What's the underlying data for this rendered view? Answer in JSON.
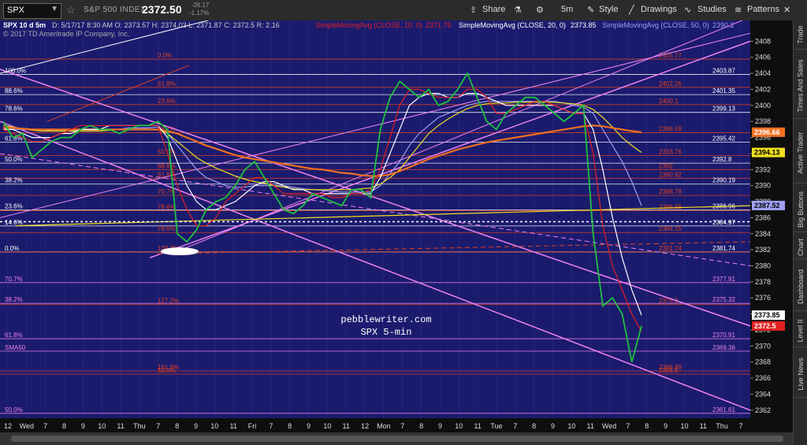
{
  "toolbar": {
    "symbol": "SPX",
    "index_name": "S&P 500 INDEX",
    "price": "2372.50",
    "change": "-26.17",
    "change_pct": "-1.17%",
    "share": "Share",
    "interval": "5m",
    "style": "Style",
    "drawings": "Drawings",
    "studies": "Studies",
    "patterns": "Patterns"
  },
  "sidebar": [
    "Trade",
    "Times And Sales",
    "Active Trader",
    "Big Buttons",
    "Chart",
    "Dashboard",
    "Level II",
    "Live News"
  ],
  "chart_data": {
    "type": "line",
    "title": "SPX 10 d 5m",
    "header_info": "D: 5/17/17 8:30 AM  O: 2373.57  H: 2374.03  L: 2371.87  C: 2372.5  R: 2.16",
    "studies": [
      {
        "label": "SimpleMovingAvg (CLOSE, 10, 0)",
        "value": "2371.79",
        "color": "#e02020"
      },
      {
        "label": "SimpleMovingAvg (CLOSE, 20, 0)",
        "value": "2373.85",
        "color": "#ffffff"
      },
      {
        "label": "SimpleMovingAvg (CLOSE, 50, 0)",
        "value": "2390.2",
        "color": "#9f9ff4"
      }
    ],
    "copyright": "© 2017 TD Ameritrade IP Company, Inc.",
    "watermark": [
      "pebblewriter.com",
      "SPX 5-min"
    ],
    "ylim": [
      2361,
      2410
    ],
    "y_ticks": [
      2362,
      2364,
      2366,
      2368,
      2370,
      2372,
      2374,
      2376,
      2378,
      2380,
      2382,
      2384,
      2386,
      2388,
      2390,
      2392,
      2394,
      2396,
      2398,
      2400,
      2402,
      2404,
      2406,
      2408
    ],
    "x_ticks": [
      "12",
      "Wed",
      "7",
      "8",
      "9",
      "10",
      "11",
      "Thu",
      "7",
      "8",
      "9",
      "10",
      "11",
      "Fri",
      "7",
      "8",
      "9",
      "10",
      "11",
      "12",
      "Mon",
      "7",
      "8",
      "9",
      "10",
      "11",
      "Tue",
      "7",
      "8",
      "9",
      "10",
      "11",
      "Wed",
      "7",
      "8",
      "9",
      "10",
      "11",
      "Thu",
      "7"
    ],
    "price_tags": [
      {
        "value": "2396.66",
        "color": "#f07020"
      },
      {
        "value": "2394.13",
        "color": "#f0e020"
      },
      {
        "value": "2387.52",
        "color": "#9f9ff4"
      },
      {
        "value": "2373.85",
        "color": "#ffffff"
      },
      {
        "value": "2372.5",
        "color": "#e02020"
      }
    ],
    "horizontal_levels": [
      {
        "value": 2405.77,
        "label_left": "0.0%",
        "label_right": "2405.77",
        "color": "#e04020"
      },
      {
        "value": 2403.87,
        "label_left": "100.0%",
        "label_right": "2403.87",
        "color": "#ffffff"
      },
      {
        "value": 2402.26,
        "label_left": "61.8%",
        "label_right": "2402.26",
        "color": "#e04020"
      },
      {
        "value": 2401.35,
        "label_left": "88.6%",
        "label_right": "2401.35",
        "color": "#ffffff"
      },
      {
        "value": 2400.1,
        "label_left": "23.6%",
        "label_right": "2400.1",
        "color": "#e04020"
      },
      {
        "value": 2399.13,
        "label_left": "78.6%",
        "label_right": "2399.13",
        "color": "#ffffff"
      },
      {
        "value": 2396.59,
        "label_left": "38.2%",
        "label_right": "2396.59",
        "color": "#e04020"
      },
      {
        "value": 2395.42,
        "label_left": "61.8%",
        "label_right": "2395.42",
        "color": "#ffffff"
      },
      {
        "value": 2393.76,
        "label_left": "50.0%",
        "label_right": "2393.76",
        "color": "#e04020"
      },
      {
        "value": 2392.8,
        "label_left": "50.0%",
        "label_right": "2392.8",
        "color": "#ffffff"
      },
      {
        "value": 2392,
        "label_left": "88.6%",
        "label_right": "2392",
        "color": "#e04020"
      },
      {
        "value": 2390.92,
        "label_left": "61.8%",
        "label_right": "2390.92",
        "color": "#e04020"
      },
      {
        "value": 2390.19,
        "label_left": "38.2%",
        "label_right": "2390.19",
        "color": "#ffffff"
      },
      {
        "value": 2388.78,
        "label_left": "70.7%",
        "label_right": "2388.78",
        "color": "#e04020"
      },
      {
        "value": 2386.96,
        "label_left": "23.6%",
        "label_right": "2386.96",
        "color": "#ffffff"
      },
      {
        "value": 2386.88,
        "label_left": "78.6%",
        "label_right": "2386.88",
        "color": "#e04020"
      },
      {
        "value": 2384.97,
        "label_left": "14.6%",
        "label_right": "2384.97",
        "color": "#ffffff"
      },
      {
        "value": 2384.15,
        "label_left": "78.6%",
        "label_right": "2384.15",
        "color": "#e04020"
      },
      {
        "value": 2381.74,
        "label_left": "0.0%",
        "label_right": "2381.74",
        "color": "#ffffff"
      },
      {
        "value": 2381.74,
        "label_left": "100.0%",
        "label_right": "2381.74",
        "color": "#e04020"
      },
      {
        "value": 2377.91,
        "label_left": "70.7%",
        "label_right": "2377.91",
        "color": "#ee82ee"
      },
      {
        "value": 2375.32,
        "label_left": "38.2%",
        "label_right": "2375.32",
        "color": "#ee82ee"
      },
      {
        "value": 2375.2,
        "label_left": "127.2%",
        "label_right": "2375.2",
        "color": "#e04020"
      },
      {
        "value": 2370.91,
        "label_left": "61.8%",
        "label_right": "2370.91",
        "color": "#ee82ee"
      },
      {
        "value": 2369.36,
        "label_left": "SMA50",
        "label_right": "2369.36",
        "color": "#ee82ee"
      },
      {
        "value": 2366.89,
        "label_left": "161.8%",
        "label_right": "2366.89",
        "color": "#e04020"
      },
      {
        "value": 2366.5,
        "label_left": "50.0%",
        "label_right": "2366.5",
        "color": "#e04020"
      },
      {
        "value": 2361.61,
        "label_left": "50.0%",
        "label_right": "2361.61",
        "color": "#ee82ee"
      }
    ],
    "series": [
      {
        "name": "SPX",
        "color": "#20c040",
        "values": [
          2398,
          2396,
          2396.5,
          2393.5,
          2394.5,
          2395.5,
          2396,
          2396,
          2397,
          2397.5,
          2397,
          2397,
          2396.5,
          2397,
          2397.5,
          2397.5,
          2398,
          2397,
          2384,
          2383,
          2384.5,
          2387,
          2388,
          2388.5,
          2390,
          2392,
          2393,
          2391,
          2389,
          2387,
          2386.5,
          2387.5,
          2389,
          2388.5,
          2388,
          2387.5,
          2389.5,
          2389.5,
          2388.5,
          2397,
          2401,
          2403,
          2402,
          2401,
          2402,
          2400,
          2400.5,
          2402,
          2404,
          2401,
          2398,
          2397,
          2399,
          2400,
          2401,
          2401,
          2400,
          2399,
          2398,
          2399,
          2400,
          2384,
          2375,
          2376,
          2374,
          2368,
          2372.5
        ]
      },
      {
        "name": "SMA10",
        "color": "#e02020",
        "values": [
          2397,
          2396.5,
          2396,
          2395.5,
          2395.5,
          2396,
          2396.5,
          2397,
          2397.5,
          2397.5,
          2397.5,
          2397.5,
          2397.5,
          2397.5,
          2397.5,
          2397.5,
          2397.5,
          2394,
          2390,
          2387,
          2385,
          2385,
          2386,
          2388,
          2389,
          2390,
          2391,
          2391,
          2390,
          2389,
          2389,
          2389,
          2389,
          2389,
          2388.5,
          2388.5,
          2389,
          2389,
          2389.5,
          2392,
          2396,
          2400,
          2402,
          2402,
          2401.5,
          2401,
          2401,
          2401,
          2402,
          2402,
          2401,
          2399,
          2399,
          2399.5,
          2400,
          2400.5,
          2400.5,
          2400,
          2399.5,
          2399,
          2399,
          2394,
          2385,
          2380,
          2377,
          2374,
          2371.79
        ]
      },
      {
        "name": "SMA20",
        "color": "#ffffff",
        "values": [
          2397,
          2397,
          2396.5,
          2396,
          2396,
          2396,
          2396.5,
          2396.5,
          2397,
          2397,
          2397,
          2397.5,
          2397.5,
          2397.5,
          2397.5,
          2397.5,
          2397.5,
          2396,
          2393,
          2390,
          2388,
          2387,
          2387,
          2387.5,
          2388,
          2389,
          2390,
          2390.5,
          2390.5,
          2390,
          2389.5,
          2389.5,
          2389,
          2389,
          2389,
          2389,
          2389,
          2389,
          2389,
          2391,
          2394,
          2397,
          2400,
          2401,
          2401.5,
          2401.5,
          2401,
          2401,
          2401.5,
          2401.5,
          2401,
          2400.5,
          2400,
          2400,
          2400,
          2400,
          2400,
          2400,
          2399.5,
          2399,
          2399,
          2397,
          2392,
          2386,
          2381,
          2377,
          2373.85
        ]
      },
      {
        "name": "SMA50",
        "color": "#9f9ff4",
        "values": [
          2397,
          2397,
          2397,
          2397,
          2397,
          2396.8,
          2396.8,
          2396.8,
          2397,
          2397,
          2397,
          2397,
          2397,
          2397.2,
          2397.2,
          2397.2,
          2397.3,
          2396.5,
          2395,
          2393.5,
          2392,
          2391,
          2390.5,
          2390,
          2389.8,
          2389.8,
          2390,
          2390,
          2390,
          2390,
          2389.8,
          2389.6,
          2389.5,
          2389.4,
          2389.3,
          2389.2,
          2389.2,
          2389.2,
          2389.2,
          2390,
          2391.5,
          2393,
          2395,
          2396.5,
          2397.5,
          2398.5,
          2399,
          2399.5,
          2400,
          2400.3,
          2400.5,
          2400.5,
          2400.5,
          2400.5,
          2400.5,
          2400.5,
          2400.5,
          2400.5,
          2400.3,
          2400,
          2399.8,
          2399,
          2397,
          2395,
          2393,
          2390.5,
          2387.5
        ]
      },
      {
        "name": "SMA_yellow",
        "color": "#f0e020",
        "values": [
          2397.5,
          2397.3,
          2397.1,
          2396.9,
          2396.8,
          2396.8,
          2396.8,
          2396.8,
          2396.8,
          2396.8,
          2396.8,
          2396.9,
          2397,
          2397,
          2397,
          2397,
          2397,
          2396.5,
          2395.5,
          2394.5,
          2393.5,
          2392.8,
          2392.2,
          2391.7,
          2391.2,
          2390.8,
          2390.5,
          2390.3,
          2390,
          2389.8,
          2389.6,
          2389.5,
          2389.5,
          2389.5,
          2389.5,
          2389.5,
          2389.5,
          2389.6,
          2389.7,
          2390.2,
          2391,
          2392,
          2393.5,
          2395,
          2396.5,
          2397.5,
          2398.3,
          2399,
          2399.6,
          2400,
          2400.2,
          2400.3,
          2400.3,
          2400.4,
          2400.4,
          2400.4,
          2400.4,
          2400.4,
          2400.3,
          2400.2,
          2400,
          2399.5,
          2398.5,
          2397.3,
          2396,
          2395,
          2394.13
        ]
      },
      {
        "name": "SMA_orange",
        "color": "#f07020",
        "values": [
          2397.2,
          2397.2,
          2397.1,
          2397,
          2397,
          2397,
          2397,
          2397,
          2397,
          2397,
          2397,
          2397,
          2397,
          2397,
          2397,
          2397,
          2397,
          2396.8,
          2396.5,
          2396,
          2395.5,
          2395,
          2394.6,
          2394.2,
          2393.8,
          2393.5,
          2393.3,
          2393.1,
          2392.9,
          2392.7,
          2392.5,
          2392.3,
          2392.1,
          2392,
          2391.8,
          2391.6,
          2391.5,
          2391.3,
          2391.2,
          2391.2,
          2391.4,
          2391.8,
          2392.3,
          2392.8,
          2393.3,
          2393.7,
          2394.1,
          2394.5,
          2394.8,
          2395.1,
          2395.4,
          2395.6,
          2395.8,
          2396,
          2396.2,
          2396.4,
          2396.6,
          2396.8,
          2397,
          2397.2,
          2397.4,
          2397.5,
          2397.4,
          2397.2,
          2397,
          2396.8,
          2396.66
        ]
      }
    ]
  }
}
